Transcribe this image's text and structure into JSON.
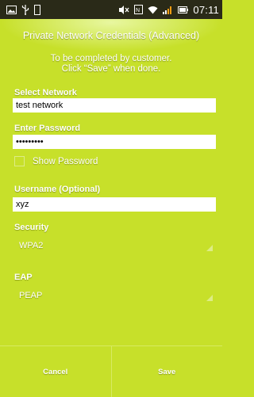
{
  "status_bar": {
    "time": "07:11",
    "icons": [
      "image-icon",
      "usb-icon",
      "phone-icon",
      "mute-icon",
      "nfc-icon",
      "wifi-icon",
      "signal-icon",
      "battery-icon"
    ]
  },
  "header": {
    "title": "Private Network Credentials (Advanced)"
  },
  "instructions": {
    "line1": "To be completed by customer.",
    "line2": "Click “Save” when done."
  },
  "form": {
    "network_label": "Select Network",
    "network_value": "test network",
    "password_label": "Enter Password",
    "password_value": "•••••••••",
    "show_password_label": "Show Password",
    "username_label": "Username (Optional)",
    "username_value": "xyz",
    "security_label": "Security",
    "security_value": "WPA2",
    "eap_label": "EAP",
    "eap_value": "PEAP"
  },
  "buttons": {
    "cancel": "Cancel",
    "save": "Save"
  },
  "colors": {
    "background": "#c7e02a",
    "status_bar": "#2a2a18",
    "text": "#ffffff"
  }
}
